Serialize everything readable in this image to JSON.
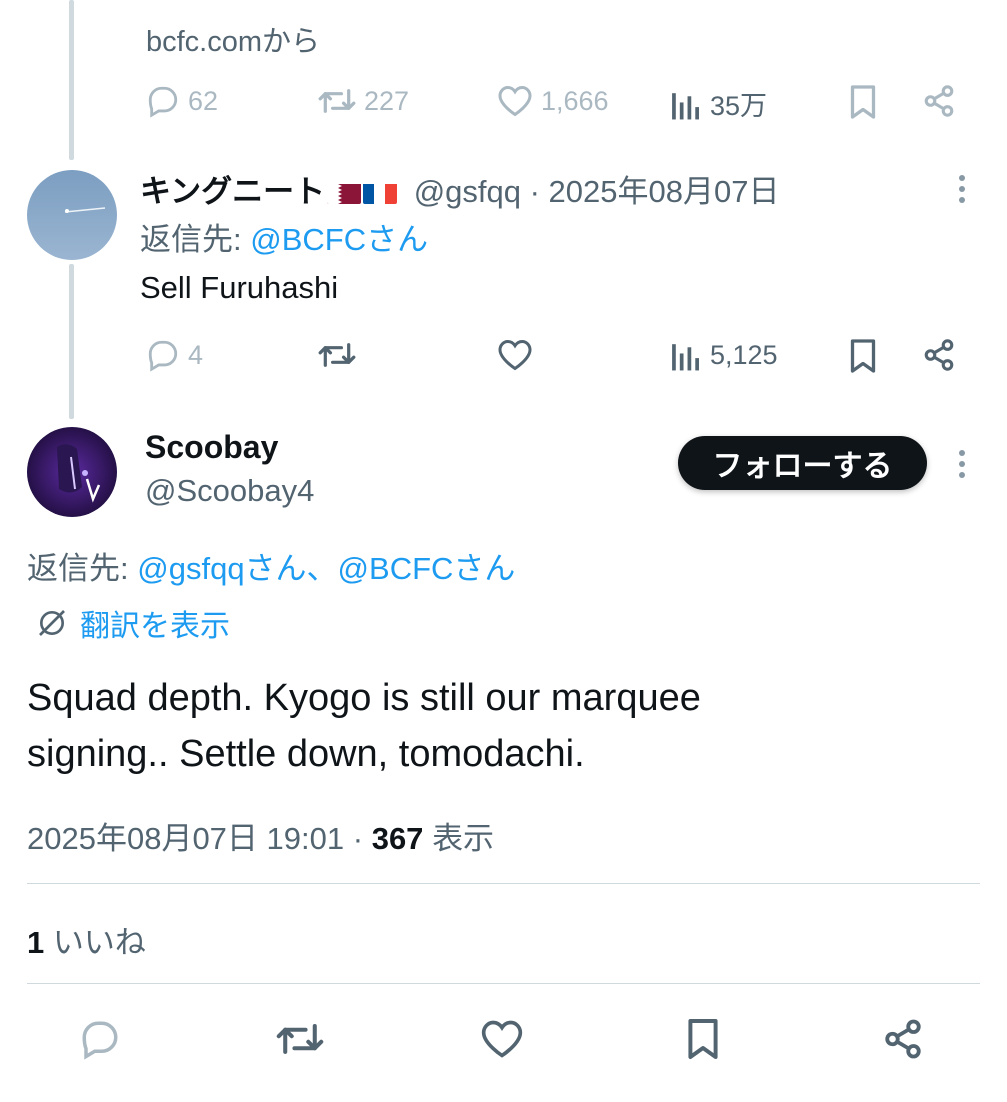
{
  "prev_tweet": {
    "source": "bcfc.comから",
    "actions": {
      "replies": "62",
      "retweets": "227",
      "likes": "1,666",
      "views": "35万"
    }
  },
  "reply_tweet": {
    "display_name": "キングニート",
    "handle_time": "@gsfqq · 2025年08月07日",
    "reply_prefix": "返信先:",
    "reply_to": "@BCFCさん",
    "text": "Sell Furuhashi",
    "actions": {
      "replies": "4",
      "views": "5,125"
    }
  },
  "main_tweet": {
    "display_name": "Scoobay",
    "handle": "@Scoobay4",
    "follow_label": "フォローする",
    "reply_prefix": "返信先:",
    "reply_to": "@gsfqqさん、@BCFCさん",
    "translate_label": "翻訳を表示",
    "text_line1": "Squad depth. Kyogo is still our marquee",
    "text_line2": "signing.. Settle down, tomodachi.",
    "timestamp": "2025年08月07日 19:01",
    "separator": "·",
    "views_count": "367",
    "views_label": "表示",
    "likes_count": "1",
    "likes_label": "いいね"
  },
  "colors": {
    "link": "#1d9bf0",
    "muted": "#536471",
    "dark": "#0f1419",
    "divider": "#cfd9de"
  },
  "icons": [
    "reply-icon",
    "retweet-icon",
    "like-icon",
    "views-icon",
    "bookmark-icon",
    "share-icon",
    "more-icon",
    "translate-icon"
  ]
}
